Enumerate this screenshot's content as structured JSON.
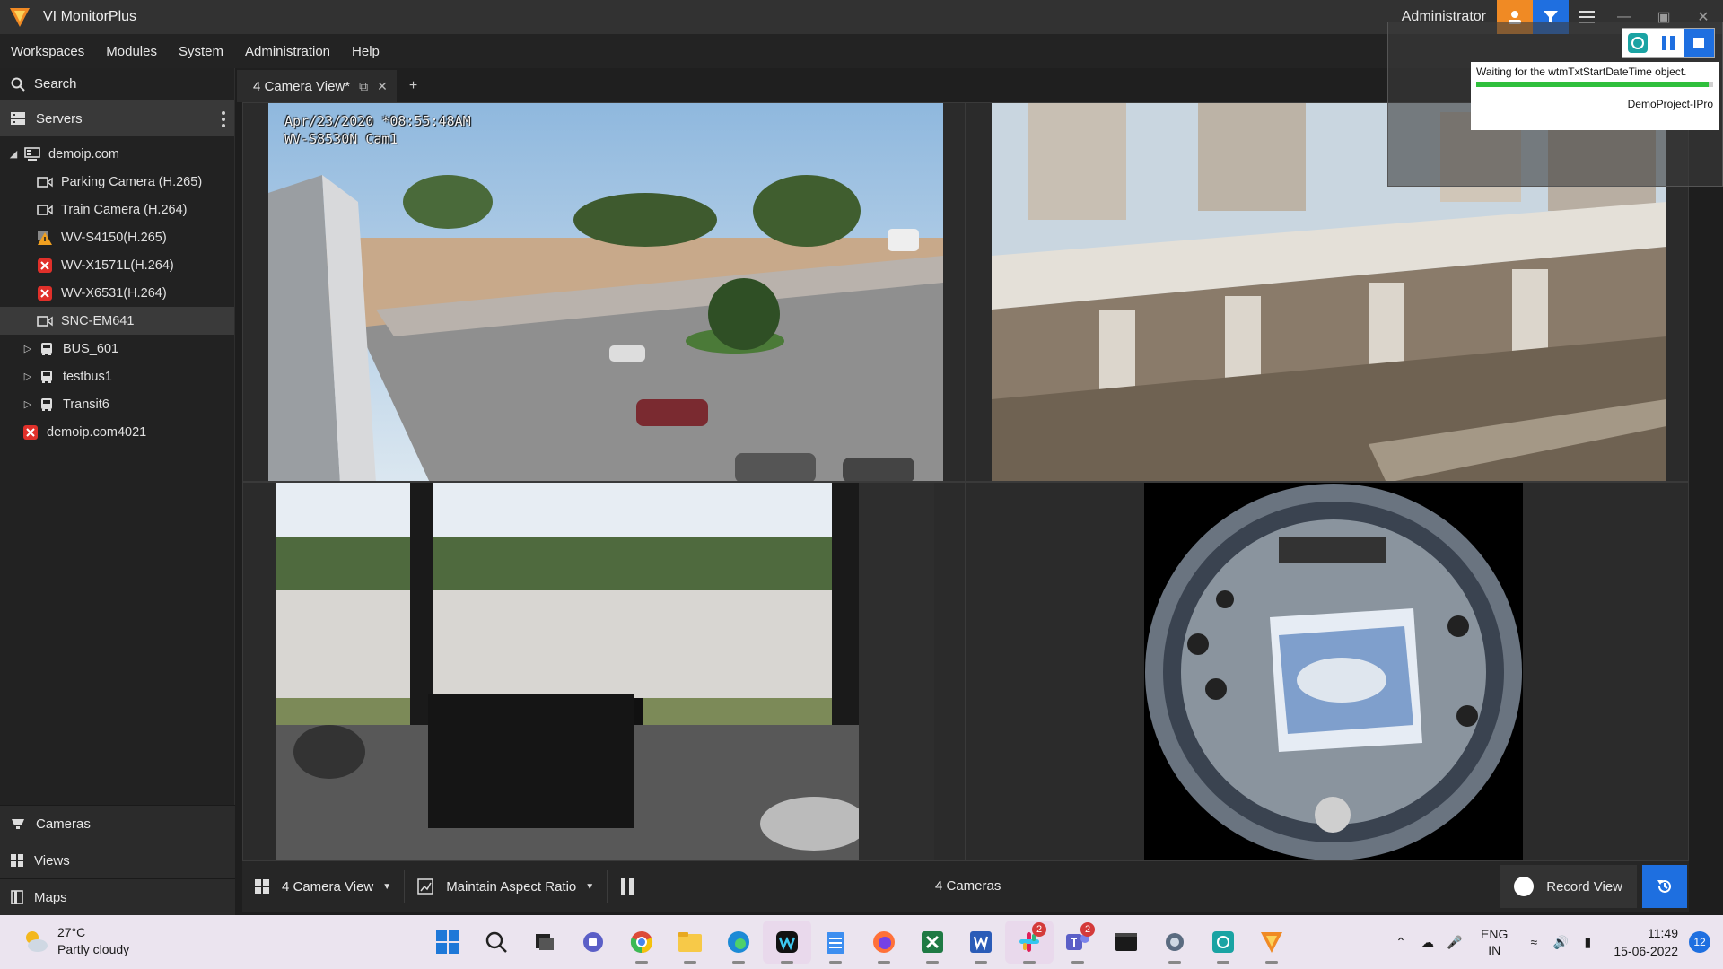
{
  "app": {
    "title": "VI MonitorPlus",
    "user": "Administrator",
    "brand_color": "#f08a24",
    "accent_color": "#1f6fe0"
  },
  "menu": [
    "Workspaces",
    "Modules",
    "System",
    "Administration",
    "Help"
  ],
  "sidebar": {
    "search_label": "Search",
    "servers_label": "Servers",
    "tree": [
      {
        "label": "demoip.com",
        "icon": "server-icon"
      },
      {
        "label": "Parking Camera (H.265)",
        "icon": "camera-icon"
      },
      {
        "label": "Train Camera (H.264)",
        "icon": "camera-icon"
      },
      {
        "label": "WV-S4150(H.265)",
        "icon": "camera-warning-icon"
      },
      {
        "label": "WV-X1571L(H.264)",
        "icon": "camera-error-icon"
      },
      {
        "label": "WV-X6531(H.264)",
        "icon": "camera-error-icon"
      },
      {
        "label": "SNC-EM641",
        "icon": "camera-icon"
      },
      {
        "label": "BUS_601",
        "icon": "bus-icon"
      },
      {
        "label": "testbus1",
        "icon": "bus-icon"
      },
      {
        "label": "Transit6",
        "icon": "bus-icon"
      },
      {
        "label": "demoip.com4021",
        "icon": "server-error-icon"
      }
    ],
    "nav": {
      "cameras": "Cameras",
      "views": "Views",
      "maps": "Maps"
    }
  },
  "tabs": {
    "active": "4 Camera View*",
    "add": "+"
  },
  "cameras": {
    "cam1_osd_line1": "Apr/23/2020 *08:55:48AM",
    "cam1_osd_line2": "WV-S8530N Cam1"
  },
  "statusbar": {
    "view_label": "4 Camera View",
    "aspect_label": "Maintain Aspect Ratio",
    "count_label": "4 Cameras",
    "record_label": "Record View"
  },
  "popup": {
    "message": "Waiting for the wtmTxtStartDateTime object.",
    "progress": 0.98,
    "project": "DemoProject-IPro"
  },
  "taskbar": {
    "temperature": "27°C",
    "condition": "Partly cloudy",
    "slack_badge": "2",
    "teams_badge": "2",
    "lang_top": "ENG",
    "lang_bottom": "IN",
    "time": "11:49",
    "date": "15-06-2022",
    "notifications": "12"
  }
}
